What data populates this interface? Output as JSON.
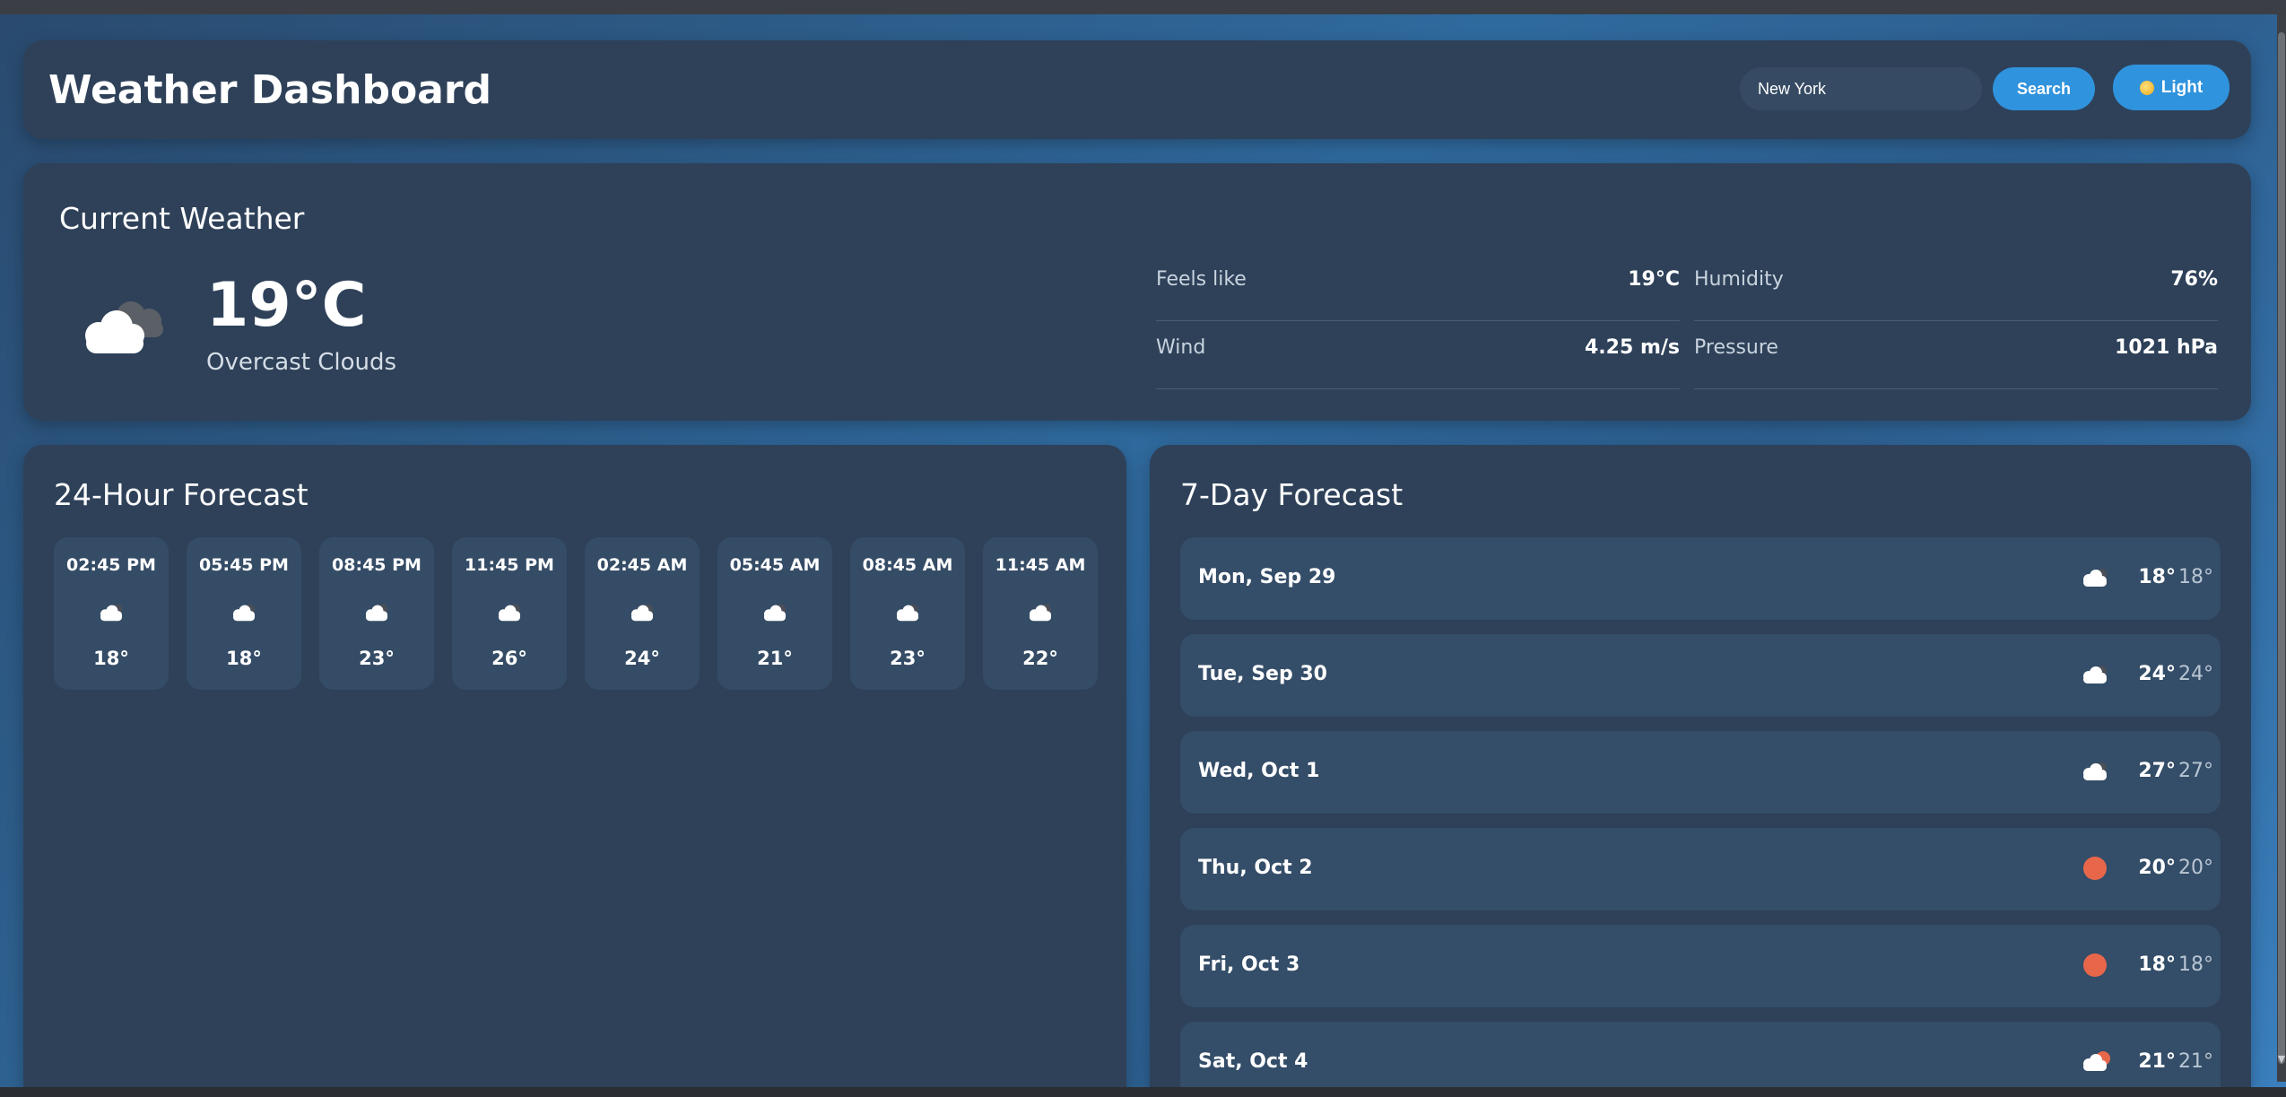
{
  "app": {
    "title": "Weather Dashboard"
  },
  "search": {
    "value": "New York",
    "placeholder": "New York",
    "button_label": "Search"
  },
  "theme_toggle": {
    "label": "Light",
    "icon": "sun-icon"
  },
  "current": {
    "title": "Current Weather",
    "icon": "overcast-cloud-icon",
    "temperature": "19°C",
    "description": "Overcast Clouds",
    "details": [
      {
        "label": "Feels like",
        "value": "19°C"
      },
      {
        "label": "Humidity",
        "value": "76%"
      },
      {
        "label": "Wind",
        "value": "4.25 m/s"
      },
      {
        "label": "Pressure",
        "value": "1021 hPa"
      }
    ]
  },
  "hourly": {
    "title": "24-Hour Forecast",
    "items": [
      {
        "time": "02:45 PM",
        "temp": "18°",
        "icon": "cloud-icon"
      },
      {
        "time": "05:45 PM",
        "temp": "18°",
        "icon": "cloud-icon"
      },
      {
        "time": "08:45 PM",
        "temp": "23°",
        "icon": "cloud-icon"
      },
      {
        "time": "11:45 PM",
        "temp": "26°",
        "icon": "cloud-icon"
      },
      {
        "time": "02:45 AM",
        "temp": "24°",
        "icon": "cloud-icon"
      },
      {
        "time": "05:45 AM",
        "temp": "21°",
        "icon": "cloud-icon"
      },
      {
        "time": "08:45 AM",
        "temp": "23°",
        "icon": "cloud-icon"
      },
      {
        "time": "11:45 AM",
        "temp": "22°",
        "icon": "cloud-icon"
      }
    ]
  },
  "daily": {
    "title": "7-Day Forecast",
    "items": [
      {
        "day": "Mon, Sep 29",
        "max": "18°",
        "min": "18°",
        "icon": "cloud-icon"
      },
      {
        "day": "Tue, Sep 30",
        "max": "24°",
        "min": "24°",
        "icon": "cloud-icon"
      },
      {
        "day": "Wed, Oct 1",
        "max": "27°",
        "min": "27°",
        "icon": "cloud-icon"
      },
      {
        "day": "Thu, Oct 2",
        "max": "20°",
        "min": "20°",
        "icon": "sun-icon"
      },
      {
        "day": "Fri, Oct 3",
        "max": "18°",
        "min": "18°",
        "icon": "sun-icon"
      },
      {
        "day": "Sat, Oct 4",
        "max": "21°",
        "min": "21°",
        "icon": "partly-cloudy-icon"
      }
    ]
  },
  "colors": {
    "accent": "#3093dd",
    "panel": "#2e4159",
    "sun": "#e8674a"
  }
}
